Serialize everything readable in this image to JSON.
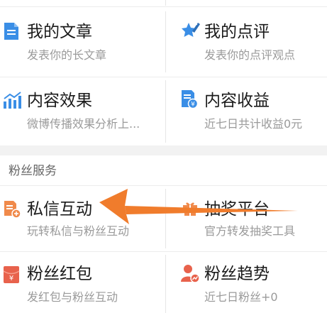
{
  "colors": {
    "icon_blue": "#3a8ee6",
    "icon_orange": "#f08a4b",
    "icon_red": "#e8624c",
    "arrow": "#f07c2c"
  },
  "items": {
    "my_articles": {
      "title": "我的文章",
      "subtitle": "发表你的长文章",
      "icon": "document-icon"
    },
    "my_reviews": {
      "title": "我的点评",
      "subtitle": "发表你的点评观点",
      "icon": "star-pen-icon"
    },
    "content_effect": {
      "title": "内容效果",
      "subtitle": "微博传播效果分析上...",
      "icon": "bar-chart-icon"
    },
    "content_income": {
      "title": "内容收益",
      "subtitle": "近七日共计收益0元",
      "icon": "yuan-document-icon"
    },
    "private_message": {
      "title": "私信互动",
      "subtitle": "玩转私信与粉丝互动",
      "icon": "message-doc-icon"
    },
    "lottery": {
      "title": "抽奖平台",
      "subtitle": "官方转发抽奖工具",
      "icon": "gift-icon"
    },
    "red_packet": {
      "title": "粉丝红包",
      "subtitle": "发红包与粉丝互动",
      "icon": "red-packet-icon"
    },
    "fan_trend": {
      "title": "粉丝趋势",
      "subtitle": "近七日粉丝+0",
      "icon": "person-trend-icon"
    }
  },
  "sections": {
    "fan_services": "粉丝服务"
  }
}
